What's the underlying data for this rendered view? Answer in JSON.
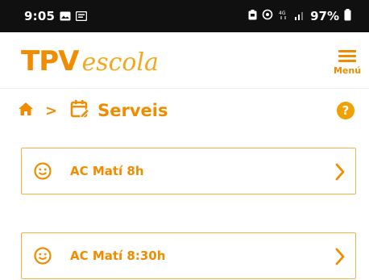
{
  "status_bar": {
    "time": "9:05",
    "battery": "97%",
    "icons": [
      "photo-icon",
      "message-icon",
      "battery-saver-icon",
      "hotspot-icon",
      "4g-icon",
      "signal-icon",
      "battery-icon"
    ]
  },
  "header": {
    "logo_bold": "TPV",
    "logo_script": "escola",
    "menu_label": "Menú"
  },
  "breadcrumb": {
    "home_icon": "home-icon",
    "separator": ">",
    "section_icon": "calendar-edit-icon",
    "title": "Serveis",
    "help_label": "?"
  },
  "services": [
    {
      "label": "AC Matí 8h",
      "icon": "smiley-icon"
    },
    {
      "label": "AC Matí 8:30h",
      "icon": "smiley-icon"
    }
  ],
  "colors": {
    "brand_orange": "#f08c00",
    "card_border": "#f5b048",
    "status_bar_bg": "#101010"
  }
}
